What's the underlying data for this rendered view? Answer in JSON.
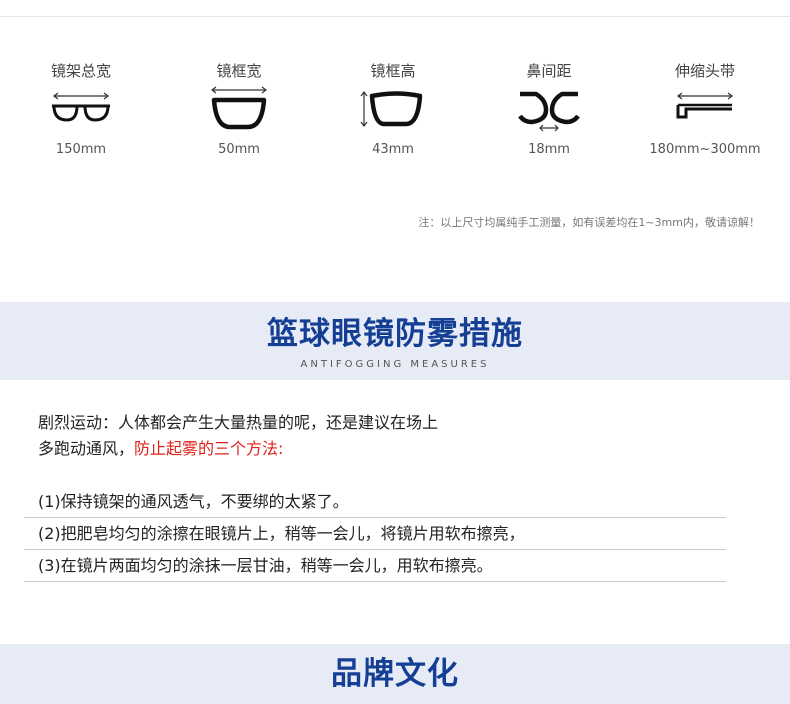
{
  "specs": [
    {
      "label": "镜架总宽",
      "value": "150mm",
      "icon": "frame-total-width-icon"
    },
    {
      "label": "镜框宽",
      "value": "50mm",
      "icon": "lens-width-icon"
    },
    {
      "label": "镜框高",
      "value": "43mm",
      "icon": "lens-height-icon"
    },
    {
      "label": "鼻间距",
      "value": "18mm",
      "icon": "bridge-width-icon"
    },
    {
      "label": "伸缩头带",
      "value": "180mm~300mm",
      "icon": "strap-length-icon"
    }
  ],
  "note": "注：以上尺寸均属纯手工测量，如有误差均在1~3mm内，敬请谅解！",
  "antifog": {
    "title": "篮球眼镜防雾措施",
    "subtitle": "ANTIFOGGING MEASURES",
    "intro_line1": "剧烈运动：人体都会产生大量热量的呢，还是建议在场上",
    "intro_line2_prefix": "多跑动通风，",
    "intro_line2_highlight": "防止起雾的三个方法:",
    "methods": [
      "(1)保持镜架的通风透气，不要绑的太紧了。",
      "(2)把肥皂均匀的涂擦在眼镜片上，稍等一会儿，将镜片用软布擦亮，",
      "(3)在镜片两面均匀的涂抹一层甘油，稍等一会儿，用软布擦亮。"
    ]
  },
  "brand": {
    "title": "品牌文化"
  },
  "colors": {
    "banner_bg": "#e7ebf6",
    "title_blue": "#143f95",
    "highlight_red": "#e0201a"
  }
}
